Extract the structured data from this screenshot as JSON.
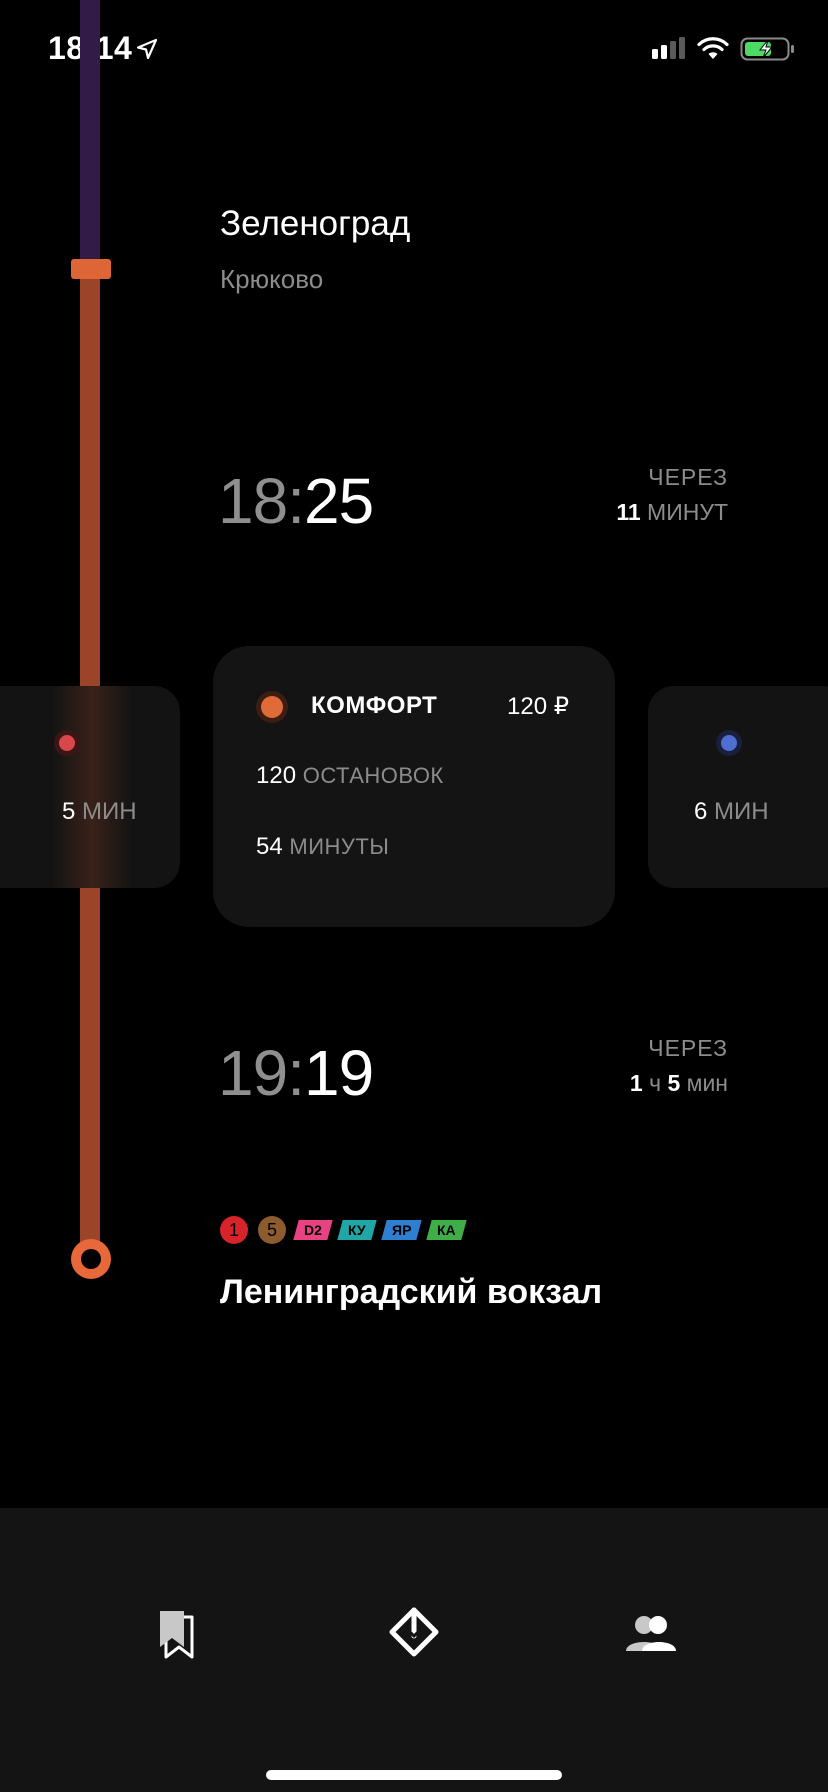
{
  "status_bar": {
    "time": "18:14",
    "icons": [
      "location-arrow-icon",
      "signal-icon",
      "wifi-icon",
      "battery-charging-icon"
    ]
  },
  "route": {
    "origin": {
      "title": "Зеленоград",
      "subtitle": "Крюково"
    },
    "departure": {
      "hours": "18:",
      "minutes": "25",
      "through_label": "ЧЕРЕЗ",
      "through_value": "11",
      "through_unit": "МИНУТ"
    },
    "arrival": {
      "hours": "19:",
      "minutes": "19",
      "through_label": "ЧЕРЕЗ",
      "h_value": "1",
      "h_unit": "ч",
      "m_value": "5",
      "m_unit": "мин"
    },
    "destination": {
      "title": "Ленинградский вокзал",
      "badges": [
        {
          "label": "1",
          "shape": "circle",
          "color": "#d8232a"
        },
        {
          "label": "5",
          "shape": "circle",
          "color": "#8d5b2d"
        },
        {
          "label": "D2",
          "shape": "parallelogram",
          "color": "#e94282"
        },
        {
          "label": "КУ",
          "shape": "parallelogram",
          "color": "#20a6a6"
        },
        {
          "label": "ЯР",
          "shape": "parallelogram",
          "color": "#2f7ed0"
        },
        {
          "label": "КА",
          "shape": "parallelogram",
          "color": "#3fae49"
        }
      ]
    },
    "colors": {
      "line_top": "#321b47",
      "line_main": "#9b4429",
      "accent": "#e06b38"
    }
  },
  "tariffs": {
    "left": {
      "value": "5",
      "unit": "МИН",
      "color": "#d9474a"
    },
    "main": {
      "name": "КОМФОРТ",
      "price": "120 ₽",
      "stops_value": "120",
      "stops_unit": "ОСТАНОВОК",
      "duration_value": "54",
      "duration_unit": "МИНУТЫ",
      "color": "#e06b38"
    },
    "right": {
      "value": "6",
      "unit": "МИН",
      "color": "#4f6ed1"
    }
  },
  "tabbar": {
    "items": [
      {
        "icon": "bookmarks-icon"
      },
      {
        "icon": "route-directions-icon"
      },
      {
        "icon": "people-icon"
      }
    ]
  }
}
